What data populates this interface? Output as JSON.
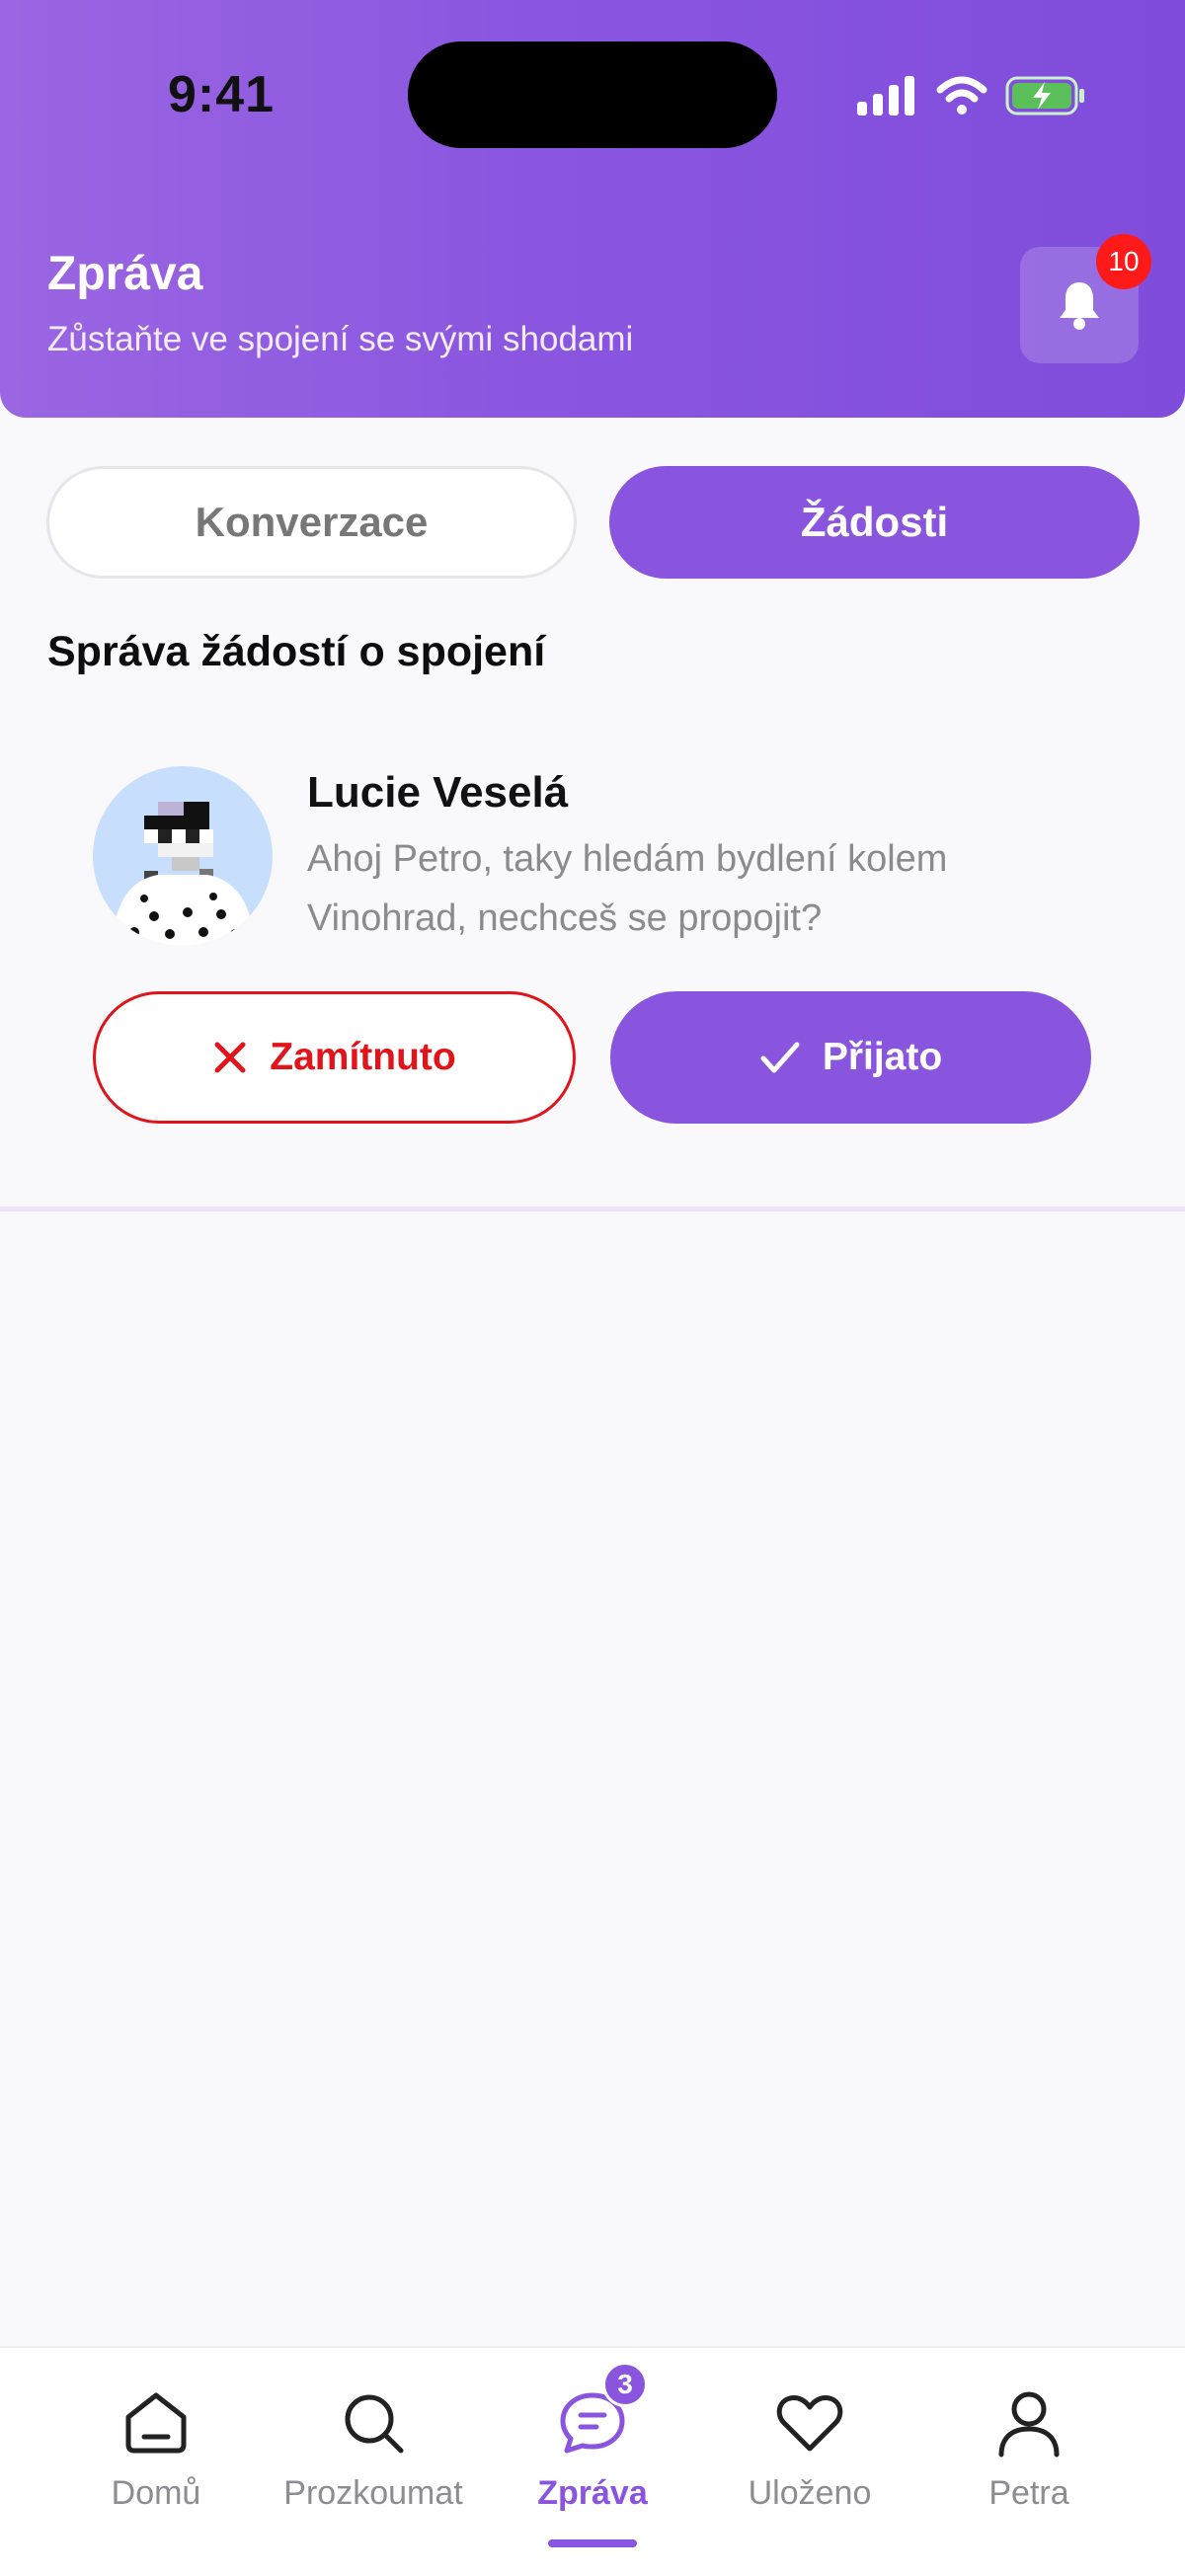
{
  "status_bar": {
    "time": "9:41"
  },
  "header": {
    "title": "Zpráva",
    "subtitle": "Zůstaňte ve spojení se svými shodami",
    "notification_count": "10"
  },
  "tabs": [
    {
      "label": "Konverzace",
      "active": false
    },
    {
      "label": "Žádosti",
      "active": true
    }
  ],
  "section_title": "Správa žádostí o spojení",
  "request": {
    "name": "Lucie Veselá",
    "message": "Ahoj Petro, taky hledám bydlení kolem Vinohrad, nechceš se propojit?",
    "reject_label": "Zamítnuto",
    "accept_label": "Přijato"
  },
  "bottom_nav": {
    "items": [
      {
        "label": "Domů",
        "icon": "home-icon"
      },
      {
        "label": "Prozkoumat",
        "icon": "search-icon"
      },
      {
        "label": "Zpráva",
        "icon": "chat-icon",
        "badge": "3",
        "active": true
      },
      {
        "label": "Uloženo",
        "icon": "heart-icon"
      },
      {
        "label": "Petra",
        "icon": "profile-icon"
      }
    ]
  },
  "colors": {
    "accent": "#8a55de",
    "reject": "#e1141b",
    "badge_red": "#ff1a1a"
  }
}
